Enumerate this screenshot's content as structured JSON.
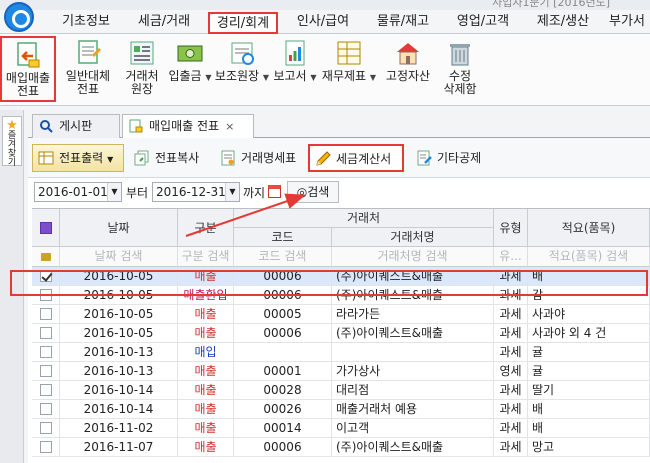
{
  "menu": {
    "title": "사업자1분기 [2016년도]",
    "items": [
      "기초정보",
      "세금/거래",
      "경리/회계",
      "인사/급여",
      "물류/재고",
      "영업/고객",
      "제조/생산",
      "부가서"
    ],
    "active": "경리/회계"
  },
  "ribbon": [
    {
      "label": "매입매출\n전표",
      "icon": "purchase-sales-voucher-icon"
    },
    {
      "label": "일반대체\n전표",
      "icon": "general-voucher-icon"
    },
    {
      "label": "거래처\n원장",
      "icon": "client-ledger-icon"
    },
    {
      "label": "입출금",
      "icon": "cash-io-icon",
      "dropdown": true
    },
    {
      "label": "보조원장",
      "icon": "sub-ledger-icon",
      "dropdown": true
    },
    {
      "label": "보고서",
      "icon": "report-icon",
      "dropdown": true
    },
    {
      "label": "재무제표",
      "icon": "financial-statement-icon",
      "dropdown": true
    },
    {
      "label": "고정자산",
      "icon": "fixed-asset-icon"
    },
    {
      "label": "수정\n삭제함",
      "icon": "trash-icon"
    }
  ],
  "favorites": {
    "label": "즐겨찾기"
  },
  "tabs": [
    {
      "label": "게시판"
    },
    {
      "label": "매입매출 전표",
      "close": "×"
    }
  ],
  "toolbar": {
    "print": "전표출력",
    "copy": "전표복사",
    "statement": "거래명세표",
    "tax_invoice": "세금계산서",
    "other_deduction": "기타공제"
  },
  "filter": {
    "from_date": "2016-01-01",
    "from_label": "부터",
    "to_date": "2016-12-31",
    "to_label": "까지",
    "search": "검색"
  },
  "grid": {
    "headers": {
      "date": "날짜",
      "type": "구분",
      "client_group": "거래처",
      "code": "코드",
      "client_name": "거래처명",
      "kind": "유형",
      "memo": "적요(품목)"
    },
    "search_row": {
      "date": "날짜 검색",
      "type": "구분 검색",
      "code": "코드 검색",
      "client_name": "거래처명 검색",
      "kind": "유...",
      "memo": "적요(품목) 검색"
    },
    "rows": [
      {
        "checked": true,
        "date": "2016-10-05",
        "type": "매출",
        "type_color": "#d32f2f",
        "code": "00006",
        "client": "(주)아이퀘스트&매출",
        "kind": "과세",
        "memo": "배"
      },
      {
        "checked": false,
        "date": "2016-10-05",
        "type": "매출환입",
        "type_color": "#c2185b",
        "code": "00006",
        "client": "(주)아이퀘스트&매출",
        "kind": "과세",
        "memo": "감"
      },
      {
        "checked": false,
        "date": "2016-10-05",
        "type": "매출",
        "type_color": "#d32f2f",
        "code": "00005",
        "client": "라라가든",
        "kind": "과세",
        "memo": "사과야"
      },
      {
        "checked": false,
        "date": "2016-10-05",
        "type": "매출",
        "type_color": "#d32f2f",
        "code": "00006",
        "client": "(주)아이퀘스트&매출",
        "kind": "과세",
        "memo": "사과야 외 4 건"
      },
      {
        "checked": false,
        "date": "2016-10-13",
        "type": "매입",
        "type_color": "#1a3fb8",
        "code": "",
        "client": "",
        "kind": "과세",
        "memo": "귤"
      },
      {
        "checked": false,
        "date": "2016-10-13",
        "type": "매출",
        "type_color": "#d32f2f",
        "code": "00001",
        "client": "가가상사",
        "kind": "영세",
        "memo": "귤"
      },
      {
        "checked": false,
        "date": "2016-10-14",
        "type": "매출",
        "type_color": "#d32f2f",
        "code": "00028",
        "client": "대리점",
        "kind": "과세",
        "memo": "딸기"
      },
      {
        "checked": false,
        "date": "2016-10-14",
        "type": "매출",
        "type_color": "#d32f2f",
        "code": "00026",
        "client": "매출거래처 예용",
        "kind": "과세",
        "memo": "배"
      },
      {
        "checked": false,
        "date": "2016-11-02",
        "type": "매출",
        "type_color": "#d32f2f",
        "code": "00014",
        "client": "이고객",
        "kind": "과세",
        "memo": "배"
      },
      {
        "checked": false,
        "date": "2016-11-07",
        "type": "매출",
        "type_color": "#d32f2f",
        "code": "00006",
        "client": "(주)아이퀘스트&매출",
        "kind": "과세",
        "memo": "망고"
      }
    ]
  },
  "colors": {
    "highlight": "#e53935",
    "accent": "#1e88e5"
  }
}
